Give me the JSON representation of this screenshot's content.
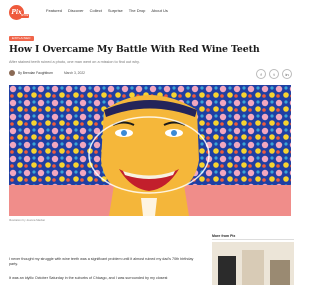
{
  "brand": {
    "logo_text": "Pix",
    "logo_tag": "SPICE",
    "accent": "#ef5a3c"
  },
  "nav": [
    "Featured",
    "Discover",
    "Collect",
    "Surprise",
    "The Drop",
    "About Us"
  ],
  "article": {
    "category": "EXPLAINED",
    "title": "How I Overcame My Battle With Red Wine Teeth",
    "subtitle": "After stained teeth ruined a photo, one man went on a mission to find out why.",
    "author": "By  Brendan Faughtburn",
    "date": "March 3, 2022",
    "image_caption": "Illustration by Joanna Maclan",
    "paragraphs": [
      "I never thought my struggle with wine teeth was a significant problem until it almost ruined my dad's 70th birthday party.",
      "It was an idyllic October Saturday in the suburbs of Chicago, and I was surrounded by my closest"
    ]
  },
  "share": [
    "f",
    "t",
    "in"
  ],
  "sidebar": {
    "heading": "More from Pix"
  }
}
